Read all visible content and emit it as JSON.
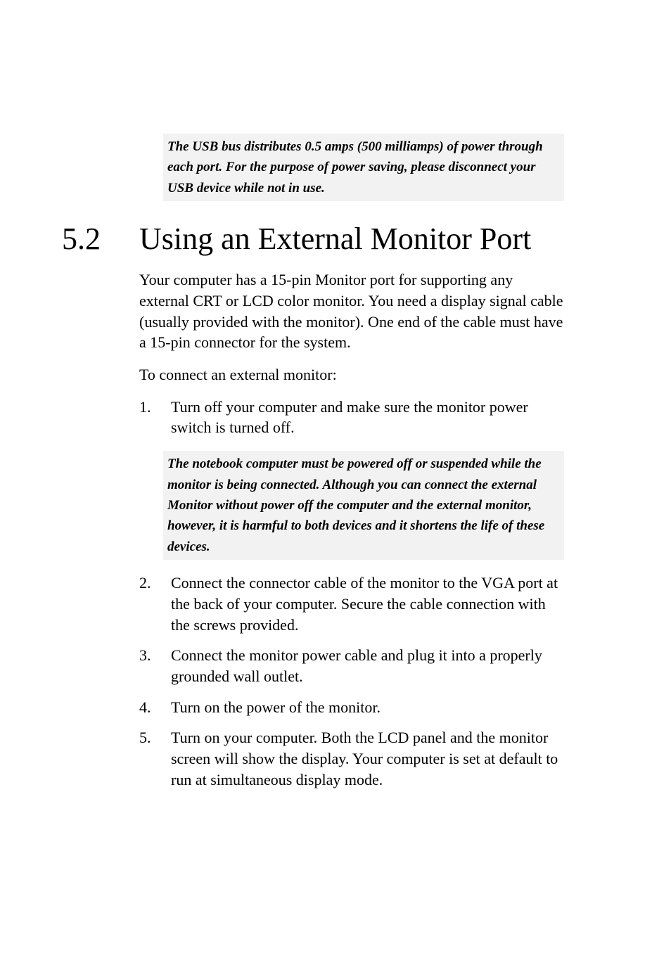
{
  "callout1": " The USB bus distributes 0.5 amps (500 milliamps) of power through each port. For the purpose of power saving, please disconnect your USB device while not in use.",
  "heading": {
    "number": "5.2",
    "text": "Using an External Monitor Port"
  },
  "intro1": "Your computer has a 15-pin Monitor port for supporting any external CRT or LCD color monitor. You need a display signal cable (usually provided with the monitor). One end of the cable must have a 15-pin connector for the system.",
  "intro2": "To connect an external monitor:",
  "steps": [
    {
      "n": "1.",
      "t": "Turn off your computer and make sure the monitor power switch is turned off."
    }
  ],
  "callout2": " The notebook computer must be powered off or suspended while the monitor is being connected. Although you can connect the external Monitor without power off the computer and the external monitor, however, it is harmful to both devices and it shortens the life of these devices.",
  "steps2": [
    {
      "n": "2.",
      "t": "Connect the connector cable of the monitor to the VGA port at the back of your computer. Secure the cable connection with the screws provided."
    },
    {
      "n": "3.",
      "t": "Connect the monitor power cable and plug it into a properly grounded wall outlet."
    },
    {
      "n": "4.",
      "t": "Turn on the power of the monitor."
    },
    {
      "n": "5.",
      "t": "Turn on your computer. Both the LCD panel and the monitor screen will show the display. Your computer is set at default to run at simultaneous display mode."
    }
  ]
}
